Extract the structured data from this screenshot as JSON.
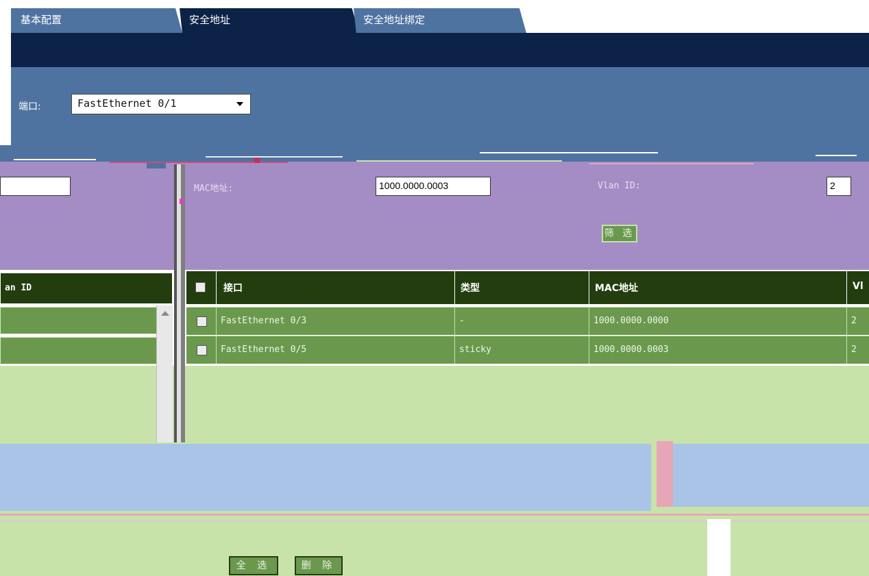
{
  "tabs": [
    {
      "label": "基本配置"
    },
    {
      "label": "安全地址"
    },
    {
      "label": "安全地址绑定"
    }
  ],
  "port": {
    "label": "端口:",
    "selected": "FastEthernet 0/1"
  },
  "filter": {
    "mac_label": "MAC地址:",
    "mac_value": "1000.0000.0003",
    "vlan_label": "Vlan ID:",
    "vlan_value": "2",
    "filter_button": "筛 选"
  },
  "left_table": {
    "header": "an ID"
  },
  "table": {
    "columns": [
      "接口",
      "类型",
      "MAC地址",
      "Vl"
    ],
    "rows": [
      {
        "interface": "FastEthernet 0/3",
        "type": "-",
        "mac": "1000.0000.0000",
        "vlan": "2"
      },
      {
        "interface": "FastEthernet 0/5",
        "type": "sticky",
        "mac": "1000.0000.0003",
        "vlan": "2"
      }
    ]
  },
  "actions": {
    "select_all": "全 选",
    "delete": "删 除"
  },
  "colors": {
    "tab_active": "#0c2246",
    "tab_inactive": "#4f73a1",
    "filter_panel": "#a48cc4",
    "table_header": "#233d0e",
    "table_row": "#6a994e",
    "page_bg": "#c8e3a9"
  }
}
